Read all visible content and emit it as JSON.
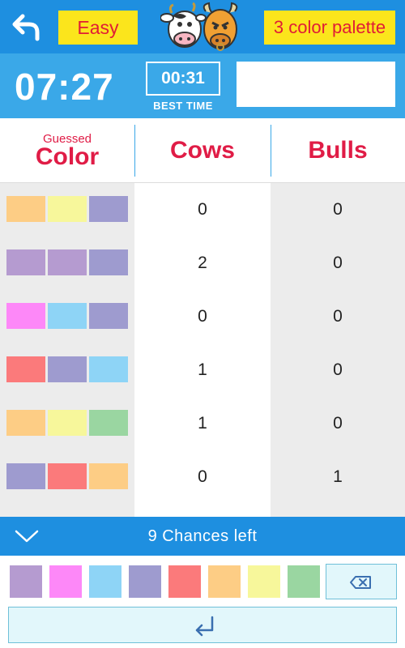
{
  "header": {
    "difficulty_label": "Easy",
    "palette_label": "3 color palette",
    "logo_icon": "cow-and-bull-logo"
  },
  "timer": {
    "elapsed": "07:27",
    "best_time": "00:31",
    "best_time_label": "BEST TIME",
    "status_text": ""
  },
  "columns": {
    "guessed_small": "Guessed",
    "guessed_big": "Color",
    "cows": "Cows",
    "bulls": "Bulls"
  },
  "colors": {
    "purple": "#b59bd0",
    "pink": "#fd88f8",
    "light_blue": "#8ed4f6",
    "slate": "#9e9bcf",
    "red": "#fb7a7b",
    "orange": "#fdcd85",
    "yellow": "#f7f79b",
    "green": "#9ad6a1",
    "accent_blue": "#1e8fe0",
    "header_red": "#e01c46",
    "button_yellow": "#fbe51c"
  },
  "guesses": [
    {
      "colors": [
        "orange",
        "yellow",
        "slate"
      ],
      "cows": "0",
      "bulls": "0"
    },
    {
      "colors": [
        "purple",
        "purple",
        "slate"
      ],
      "cows": "2",
      "bulls": "0"
    },
    {
      "colors": [
        "pink",
        "light_blue",
        "slate"
      ],
      "cows": "0",
      "bulls": "0"
    },
    {
      "colors": [
        "red",
        "slate",
        "light_blue"
      ],
      "cows": "1",
      "bulls": "0"
    },
    {
      "colors": [
        "orange",
        "yellow",
        "green"
      ],
      "cows": "1",
      "bulls": "0"
    },
    {
      "colors": [
        "slate",
        "red",
        "orange"
      ],
      "cows": "0",
      "bulls": "1"
    }
  ],
  "chances_text": "9 Chances left",
  "palette": [
    "purple",
    "pink",
    "light_blue",
    "slate",
    "red",
    "orange",
    "yellow",
    "green"
  ],
  "icons": {
    "back": "back-arrow-icon",
    "collapse": "chevron-down-icon",
    "delete": "backspace-icon",
    "enter": "enter-icon"
  }
}
